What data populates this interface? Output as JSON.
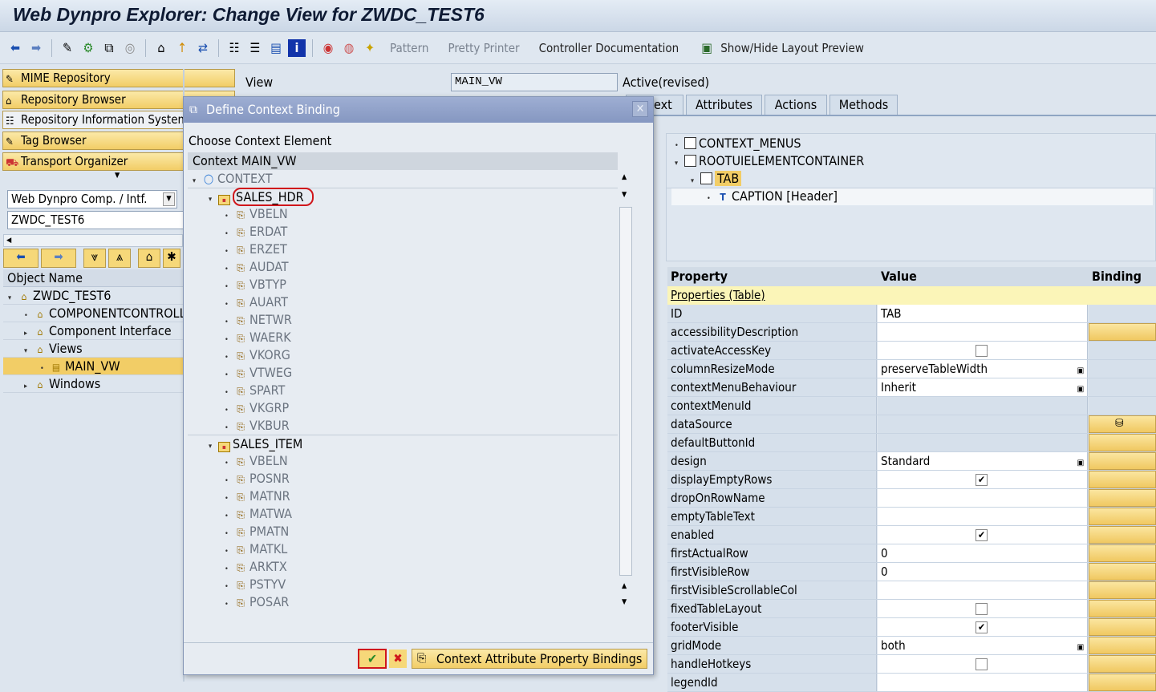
{
  "window": {
    "title": "Web Dynpro Explorer: Change View for ZWDC_TEST6"
  },
  "toolbar": {
    "pattern": "Pattern",
    "pretty_printer": "Pretty Printer",
    "controller_doc": "Controller Documentation",
    "layout_preview": "Show/Hide Layout Preview"
  },
  "nav": {
    "buttons": [
      "MIME Repository",
      "Repository Browser",
      "Repository Information System",
      "Tag Browser",
      "Transport Organizer"
    ],
    "object_type": "Web Dynpro Comp. / Intf.",
    "object_name": "ZWDC_TEST6",
    "column_header": "Object Name",
    "tree": [
      {
        "label": "ZWDC_TEST6",
        "level": 0,
        "toggle": "▾"
      },
      {
        "label": "COMPONENTCONTROLLER",
        "level": 1,
        "toggle": "•"
      },
      {
        "label": "Component Interface",
        "level": 1,
        "toggle": "▸"
      },
      {
        "label": "Views",
        "level": 1,
        "toggle": "▾"
      },
      {
        "label": "MAIN_VW",
        "level": 2,
        "toggle": "•",
        "selected": true
      },
      {
        "label": "Windows",
        "level": 1,
        "toggle": "▸"
      }
    ]
  },
  "view": {
    "label": "View",
    "name": "MAIN_VW",
    "status": "Active(revised)"
  },
  "tabs": [
    "ext",
    "Attributes",
    "Actions",
    "Methods"
  ],
  "ui_tree": [
    {
      "label": "CONTEXT_MENUS",
      "level": 0,
      "toggle": "•"
    },
    {
      "label": "ROOTUIELEMENTCONTAINER",
      "level": 0,
      "toggle": "▾"
    },
    {
      "label": "TAB",
      "level": 1,
      "toggle": "▾",
      "selected": true
    },
    {
      "label": "CAPTION  [Header]",
      "level": 2,
      "toggle": "•"
    }
  ],
  "properties": {
    "headers": [
      "Property",
      "Value",
      "Binding"
    ],
    "section": "Properties (Table)",
    "rows": [
      {
        "name": "ID",
        "value": "TAB",
        "type": "text",
        "binding": false
      },
      {
        "name": "accessibilityDescription",
        "value": "",
        "type": "text",
        "binding": true
      },
      {
        "name": "activateAccessKey",
        "type": "checkbox",
        "checked": false,
        "binding": false
      },
      {
        "name": "columnResizeMode",
        "value": "preserveTableWidth",
        "type": "dropdown",
        "binding": false
      },
      {
        "name": "contextMenuBehaviour",
        "value": "Inherit",
        "type": "dropdown",
        "binding": false
      },
      {
        "name": "contextMenuId",
        "value": "",
        "type": "readonly",
        "binding": false
      },
      {
        "name": "dataSource",
        "value": "",
        "type": "readonly",
        "binding": true,
        "bound": true
      },
      {
        "name": "defaultButtonId",
        "value": "",
        "type": "readonly",
        "binding": true
      },
      {
        "name": "design",
        "value": "Standard",
        "type": "dropdown",
        "binding": true
      },
      {
        "name": "displayEmptyRows",
        "type": "checkbox",
        "checked": true,
        "binding": true
      },
      {
        "name": "dropOnRowName",
        "value": "",
        "type": "text",
        "binding": true
      },
      {
        "name": "emptyTableText",
        "value": "",
        "type": "text",
        "binding": true
      },
      {
        "name": "enabled",
        "type": "checkbox",
        "checked": true,
        "binding": true
      },
      {
        "name": "firstActualRow",
        "value": "0",
        "type": "text",
        "binding": true
      },
      {
        "name": "firstVisibleRow",
        "value": "0",
        "type": "text",
        "binding": true
      },
      {
        "name": "firstVisibleScrollableCol",
        "value": "",
        "type": "text",
        "binding": true
      },
      {
        "name": "fixedTableLayout",
        "type": "checkbox",
        "checked": false,
        "binding": true
      },
      {
        "name": "footerVisible",
        "type": "checkbox",
        "checked": true,
        "binding": true
      },
      {
        "name": "gridMode",
        "value": "both",
        "type": "dropdown",
        "binding": true
      },
      {
        "name": "handleHotkeys",
        "type": "checkbox",
        "checked": false,
        "binding": true
      },
      {
        "name": "legendId",
        "value": "",
        "type": "text",
        "binding": true
      }
    ]
  },
  "dialog": {
    "title": "Define Context Binding",
    "subtitle": "Choose Context Element",
    "tree_header": "Context MAIN_VW",
    "tree": [
      {
        "label": "CONTEXT",
        "kind": "root"
      },
      {
        "label": "SALES_HDR",
        "kind": "node",
        "highlighted": true
      },
      {
        "label": "VBELN",
        "kind": "attr"
      },
      {
        "label": "ERDAT",
        "kind": "attr"
      },
      {
        "label": "ERZET",
        "kind": "attr"
      },
      {
        "label": "AUDAT",
        "kind": "attr"
      },
      {
        "label": "VBTYP",
        "kind": "attr"
      },
      {
        "label": "AUART",
        "kind": "attr"
      },
      {
        "label": "NETWR",
        "kind": "attr"
      },
      {
        "label": "WAERK",
        "kind": "attr"
      },
      {
        "label": "VKORG",
        "kind": "attr"
      },
      {
        "label": "VTWEG",
        "kind": "attr"
      },
      {
        "label": "SPART",
        "kind": "attr"
      },
      {
        "label": "VKGRP",
        "kind": "attr"
      },
      {
        "label": "VKBUR",
        "kind": "attr"
      },
      {
        "label": "SALES_ITEM",
        "kind": "node"
      },
      {
        "label": "VBELN",
        "kind": "attr"
      },
      {
        "label": "POSNR",
        "kind": "attr"
      },
      {
        "label": "MATNR",
        "kind": "attr"
      },
      {
        "label": "MATWA",
        "kind": "attr"
      },
      {
        "label": "PMATN",
        "kind": "attr"
      },
      {
        "label": "MATKL",
        "kind": "attr"
      },
      {
        "label": "ARKTX",
        "kind": "attr"
      },
      {
        "label": "PSTYV",
        "kind": "attr"
      },
      {
        "label": "POSAR",
        "kind": "attr"
      }
    ],
    "cab_button": "Context Attribute Property Bindings"
  },
  "colors": {
    "accent": "#f2cd66",
    "highlight": "#d0161b"
  }
}
